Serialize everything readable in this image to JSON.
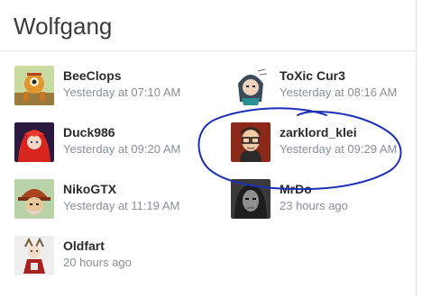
{
  "group": {
    "title": "Wolfgang"
  },
  "members": [
    {
      "name": "BeeClops",
      "time": "Yesterday at 07:10 AM",
      "avatar": "beeclops-avatar"
    },
    {
      "name": "ToXic Cur3",
      "time": "Yesterday at 08:16 AM",
      "avatar": "toxic-cur3-avatar"
    },
    {
      "name": "Duck986",
      "time": "Yesterday at 09:20 AM",
      "avatar": "duck986-avatar"
    },
    {
      "name": "zarklord_klei",
      "time": "Yesterday at 09:29 AM",
      "avatar": "zarklord-klei-avatar"
    },
    {
      "name": "NikoGTX",
      "time": "Yesterday at 11:19 AM",
      "avatar": "nikogtx-avatar"
    },
    {
      "name": "MrDo",
      "time": "23 hours ago",
      "avatar": "mrdo-avatar"
    },
    {
      "name": "Oldfart",
      "time": "20 hours ago",
      "avatar": "oldfart-avatar"
    }
  ],
  "colors": {
    "annotation_ink": "#1b2fb8",
    "timestamp": "#8a8f99"
  }
}
